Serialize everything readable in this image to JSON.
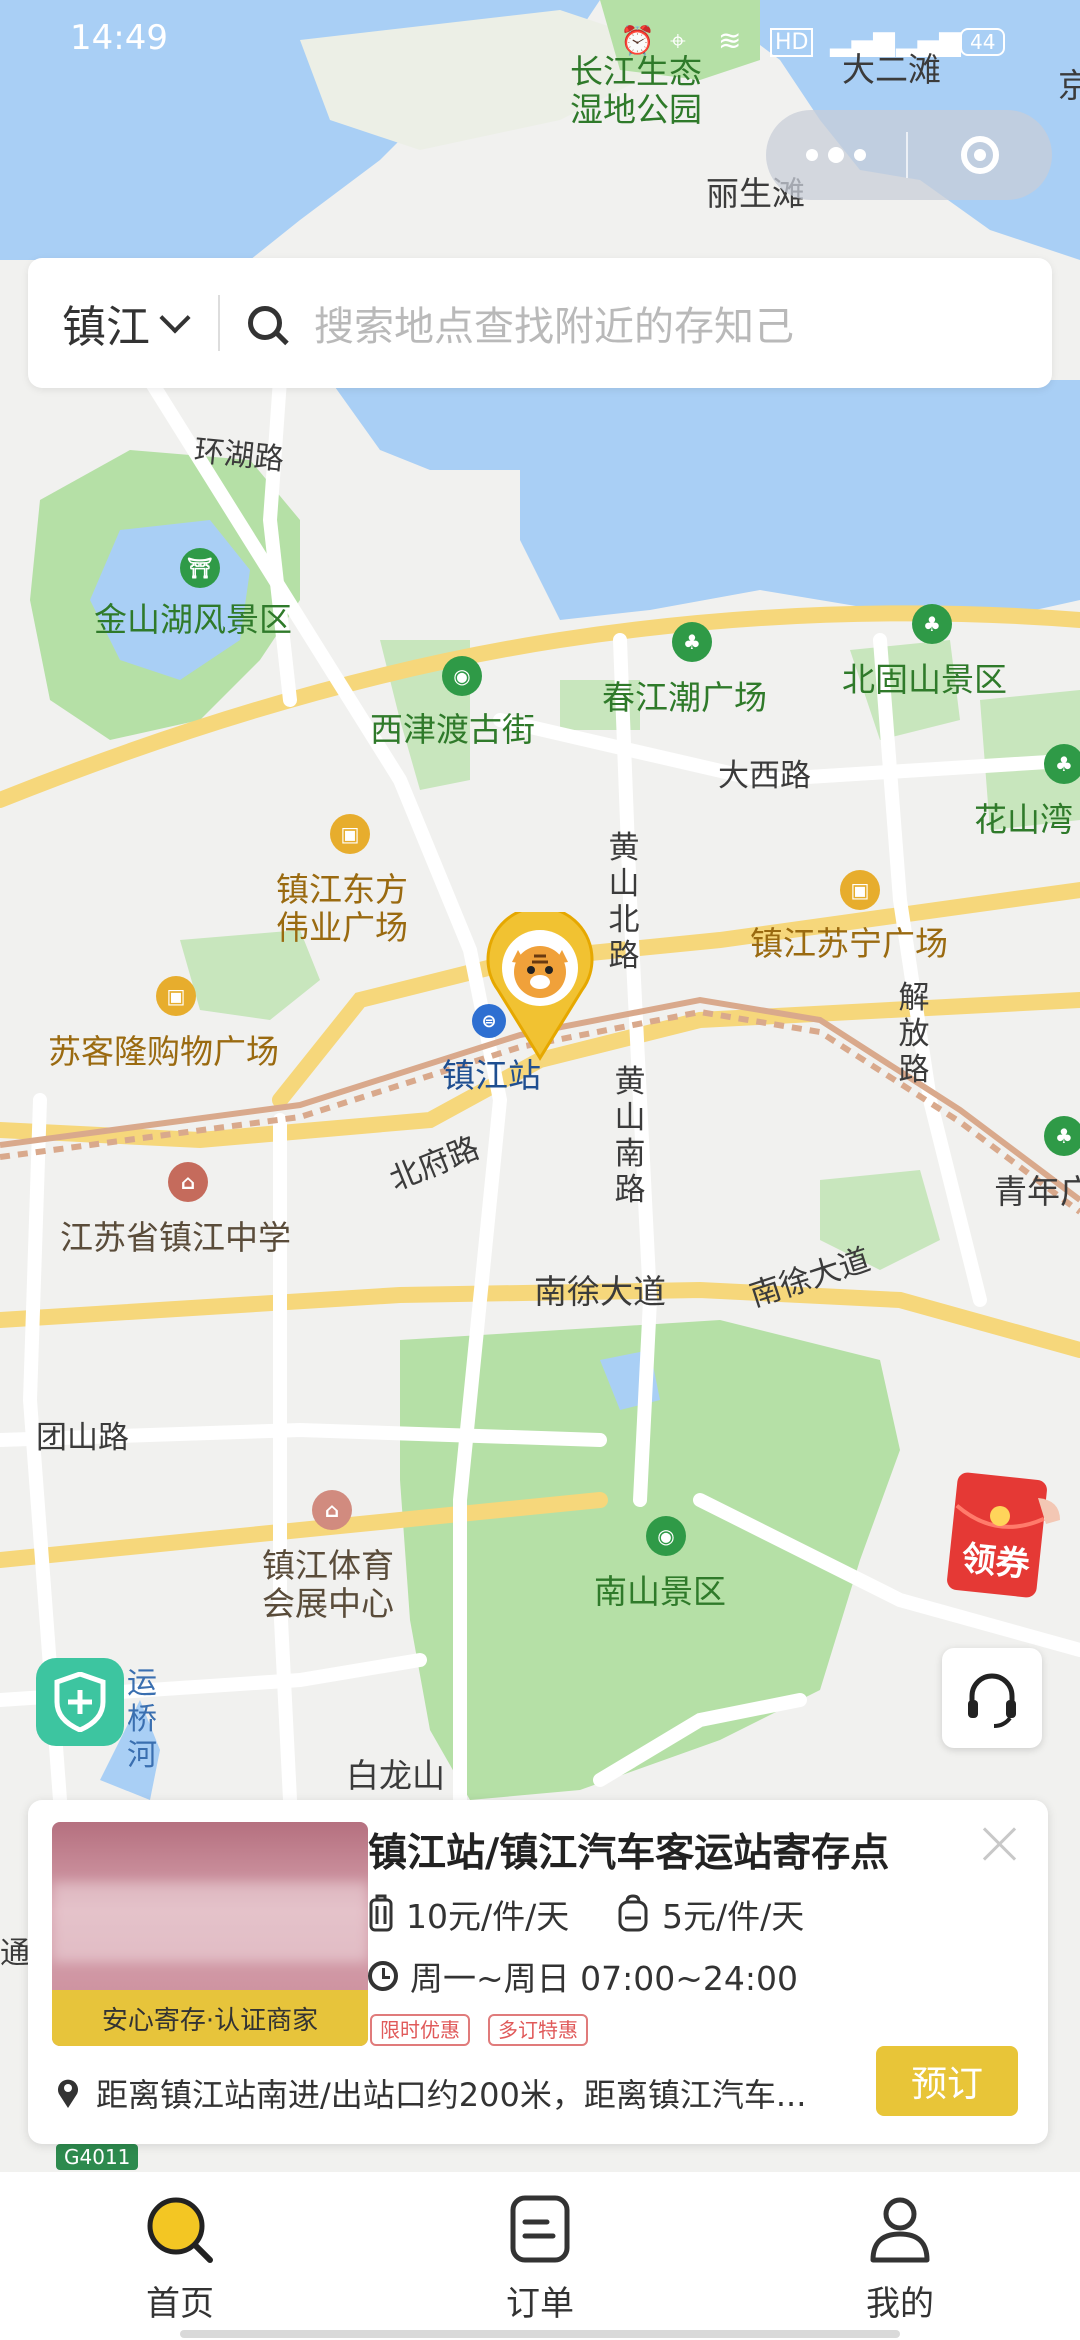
{
  "status_bar": {
    "time": "14:49",
    "icons": [
      "alarm-icon",
      "location-icon",
      "wifi-icon",
      "hd-icon",
      "signal-4g-icon",
      "signal-4g-icon",
      "battery-icon"
    ],
    "battery": "44"
  },
  "capsule": {
    "more_label": "•••",
    "close_label": "◎"
  },
  "search": {
    "city": "镇江",
    "placeholder": "搜索地点查找附近的存知己"
  },
  "map": {
    "labels": {
      "changjiang_park_1": "长江生态",
      "changjiang_park_2": "湿地公园",
      "da_er_tan": "大二滩",
      "li_sheng_tan": "丽生滩",
      "huan_hu_lu": "环湖路",
      "jinshan_lake": "金山湖风景区",
      "xijindu": "西津渡古街",
      "chunjiang": "春江潮广场",
      "beigushan": "北固山景区",
      "daxi_lu": "大西路",
      "huashan_wan": "花山湾",
      "huangshan_bei_lu": "黄山北路",
      "dongfang_1": "镇江东方",
      "dongfang_2": "伟业广场",
      "suning": "镇江苏宁广场",
      "jiefang_lu": "解放路",
      "suke": "苏客隆购物广场",
      "zhenjiang_station": "镇江站",
      "huangshan_nan_lu": "黄山南路",
      "qingnian": "青年广",
      "beifu_lu": "北府路",
      "zhenjiang_school": "江苏省镇江中学",
      "nanxu_1": "南徐大道",
      "nanxu_2": "南徐大道",
      "tuanshan_lu": "团山路",
      "tiyu_1": "镇江体育",
      "tiyu_2": "会展中心",
      "nanshan": "南山景区",
      "baolongshan": "白龙山",
      "yunqiao": "运桥河",
      "edge_tong": "通",
      "highway": "G4011",
      "top_right_edge": "京"
    }
  },
  "floating": {
    "coupon_label": "领券"
  },
  "store": {
    "title": "镇江站/镇江汽车客运站寄存点",
    "badge": "安心寄存·认证商家",
    "price_large": "10元/件/天",
    "price_small": "5元/件/天",
    "hours": "周一~周日 07:00~24:00",
    "tags": [
      "限时优惠",
      "多订特惠"
    ],
    "address": "距离镇江站南进/出站口约200米，距离镇江汽车...",
    "book_label": "预订"
  },
  "nav": {
    "items": [
      {
        "label": "首页",
        "icon": "home-search-icon",
        "active": true
      },
      {
        "label": "订单",
        "icon": "order-icon",
        "active": false
      },
      {
        "label": "我的",
        "icon": "profile-icon",
        "active": false
      }
    ]
  },
  "colors": {
    "accent": "#e8c538",
    "water": "#a9cff5",
    "park": "#b5e0a6",
    "road_major": "#f6d77b"
  }
}
